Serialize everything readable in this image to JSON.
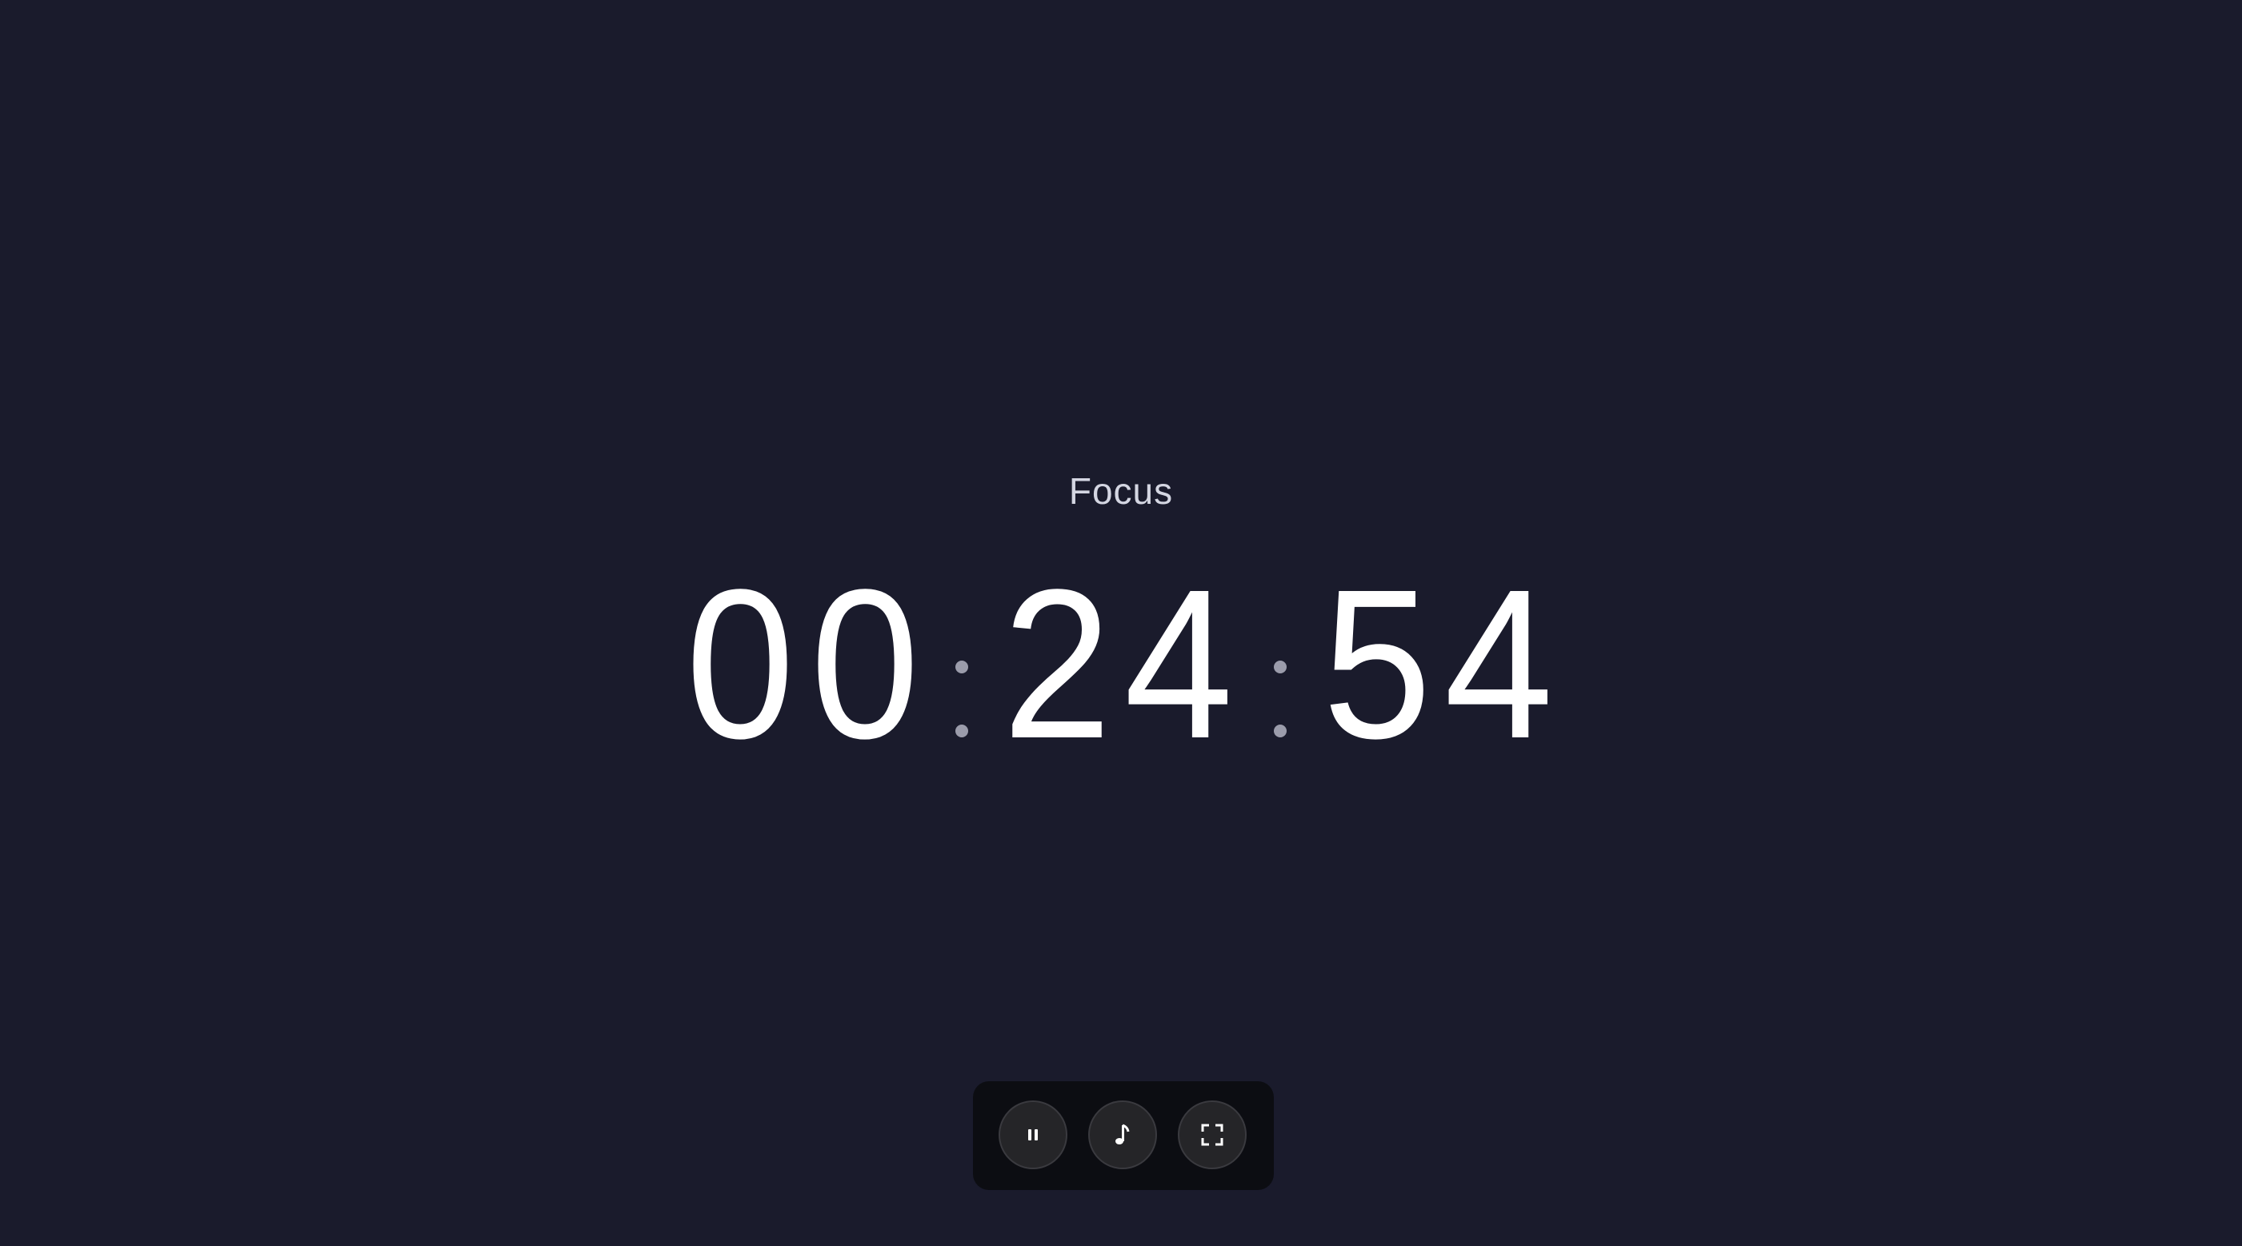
{
  "timer": {
    "mode_label": "Focus",
    "time": "00:24:54",
    "digits": {
      "h1": "0",
      "h2": "0",
      "m1": "2",
      "m2": "4",
      "s1": "5",
      "s2": "4"
    }
  },
  "controls": {
    "buttons": [
      {
        "icon": "pause-icon"
      },
      {
        "icon": "music-note-icon"
      },
      {
        "icon": "fullscreen-icon"
      }
    ]
  },
  "colors": {
    "background": "#1a1b2c",
    "digits": "#ffffff",
    "separator": "#9b9cab",
    "toolbar": "#0c0d12",
    "button": "#252528"
  }
}
